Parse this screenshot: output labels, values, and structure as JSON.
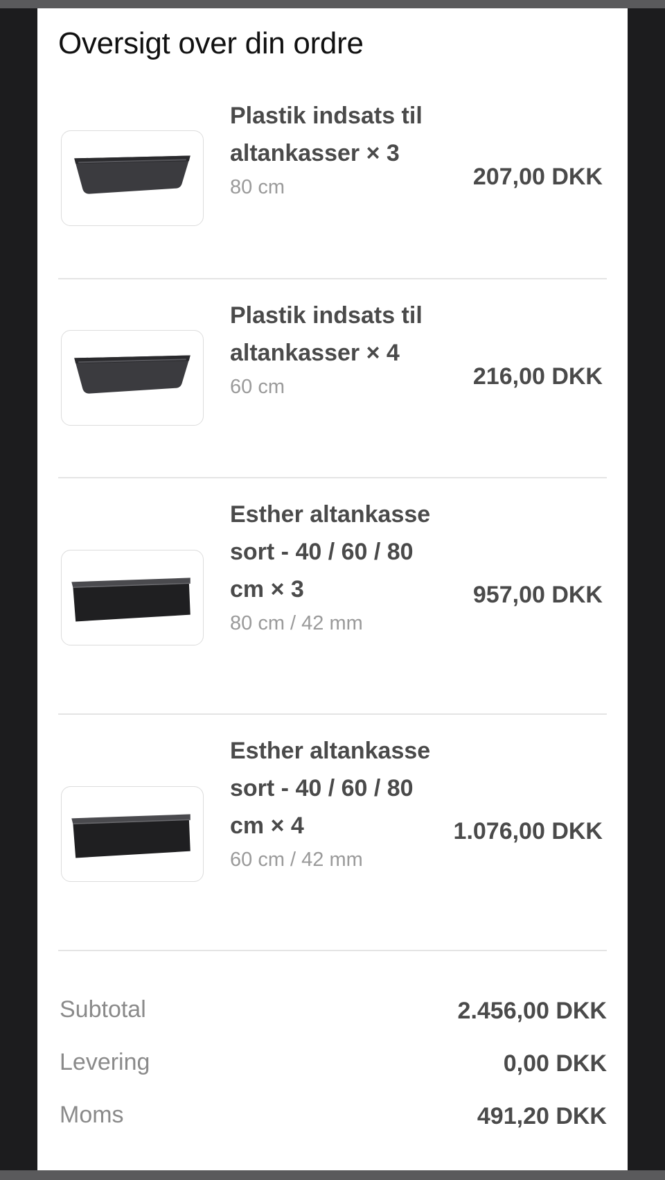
{
  "page": {
    "title": "Oversigt over din ordre"
  },
  "items": [
    {
      "name": "Plastik indsats til altankasser × 3",
      "variant": "80 cm",
      "price": "207,00 DKK",
      "image_icon": "planter-insert-image"
    },
    {
      "name": "Plastik indsats til altankasser × 4",
      "variant": "60 cm",
      "price": "216,00 DKK",
      "image_icon": "planter-insert-image"
    },
    {
      "name": "Esther altankasse sort - 40 / 60 / 80 cm × 3",
      "variant": "80 cm / 42 mm",
      "price": "957,00 DKK",
      "image_icon": "balcony-box-image"
    },
    {
      "name": "Esther altankasse sort - 40 / 60 / 80 cm × 4",
      "variant": "60 cm / 42 mm",
      "price": "1.076,00 DKK",
      "image_icon": "balcony-box-image"
    }
  ],
  "totals": {
    "subtotal_label": "Subtotal",
    "subtotal_value": "2.456,00 DKK",
    "delivery_label": "Levering",
    "delivery_value": "0,00 DKK",
    "tax_label": "Moms",
    "tax_value": "491,20 DKK"
  },
  "colors": {
    "background": "#1c1c1e",
    "card": "#ffffff",
    "text_primary": "#4a4a4a",
    "text_muted": "#9a9a9a"
  }
}
